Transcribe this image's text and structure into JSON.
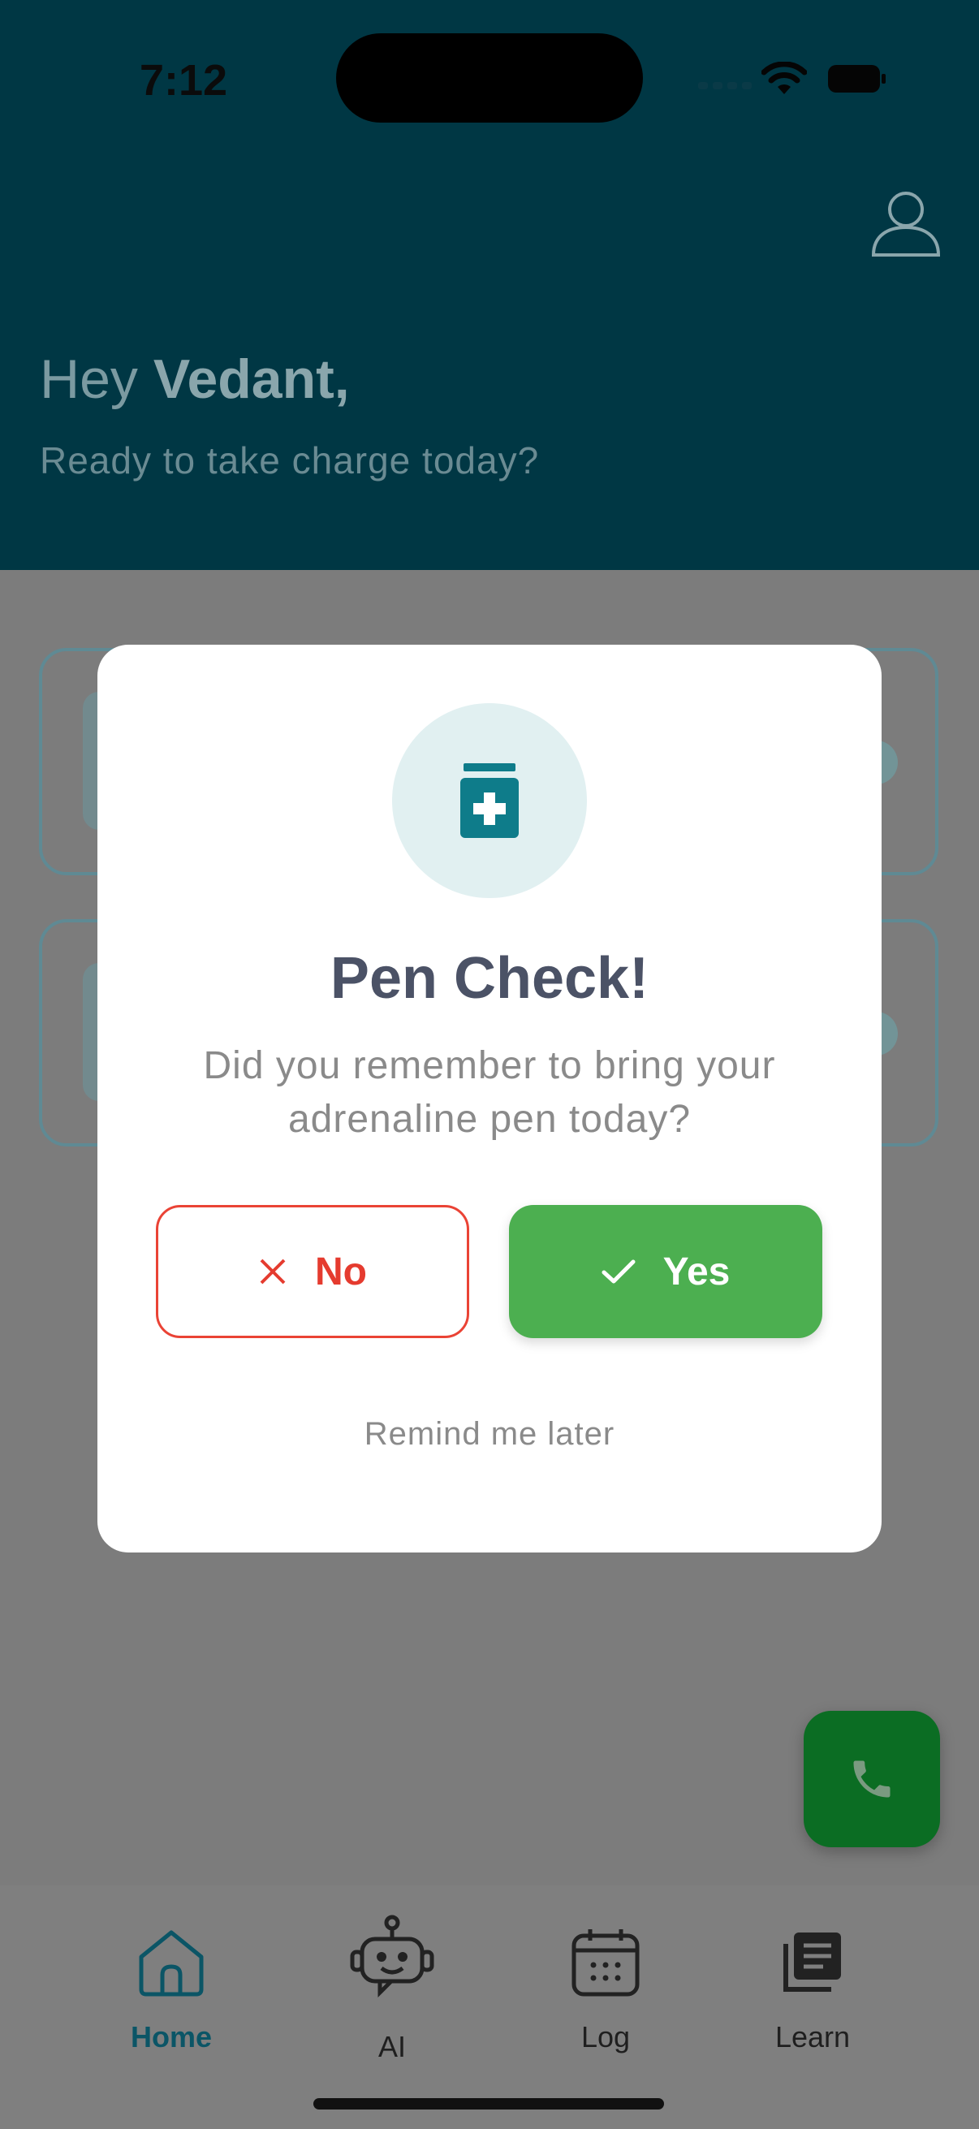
{
  "status_bar": {
    "time": "7:12"
  },
  "header": {
    "greeting_prefix": "Hey",
    "user_name": "Vedant,",
    "subtitle": "Ready to take charge today?"
  },
  "dialog": {
    "icon": "medicine-icon",
    "title": "Pen Check!",
    "message": "Did you remember to bring your adrenaline pen today?",
    "no_label": "No",
    "yes_label": "Yes",
    "remind_label": "Remind me later"
  },
  "bottom_nav": {
    "items": [
      {
        "label": "Home",
        "icon": "home-icon",
        "active": true
      },
      {
        "label": "AI",
        "icon": "robot-icon",
        "active": false
      },
      {
        "label": "Log",
        "icon": "calendar-icon",
        "active": false
      },
      {
        "label": "Learn",
        "icon": "book-icon",
        "active": false
      }
    ]
  },
  "fab": {
    "icon": "phone-icon"
  },
  "colors": {
    "header_bg": "#003744",
    "accent": "#0e7c8a",
    "yes_green": "#4caf50",
    "no_red": "#ea4335",
    "call_green": "#0b6d23"
  }
}
